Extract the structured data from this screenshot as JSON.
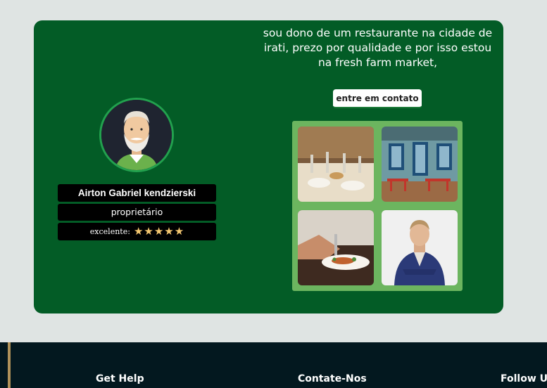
{
  "testimonial": {
    "quote": "sou dono de um restaurante na cidade de irati, prezo por qualidade e por isso estou na fresh farm market,",
    "contact_button": "entre em contato",
    "name": "Airton Gabriel kendzierski",
    "role": "proprietário",
    "rating_label": "excelente:",
    "rating_value": 5,
    "rating_max": 5,
    "star_icon": "star-icon"
  },
  "gallery": {
    "photos": [
      "restaurant-table-photo",
      "restaurant-facade-photo",
      "chef-plating-photo",
      "businessman-portrait-photo"
    ]
  },
  "footer": {
    "headings": [
      "Get Help",
      "Contate-Nos",
      "Follow Us"
    ]
  },
  "colors": {
    "page_bg": "#dfe4e3",
    "card_bg": "#035c26",
    "gallery_bg": "#6cb55f",
    "footer_bg": "#03181f",
    "star": "#f5c871",
    "accent": "#b0925a"
  }
}
